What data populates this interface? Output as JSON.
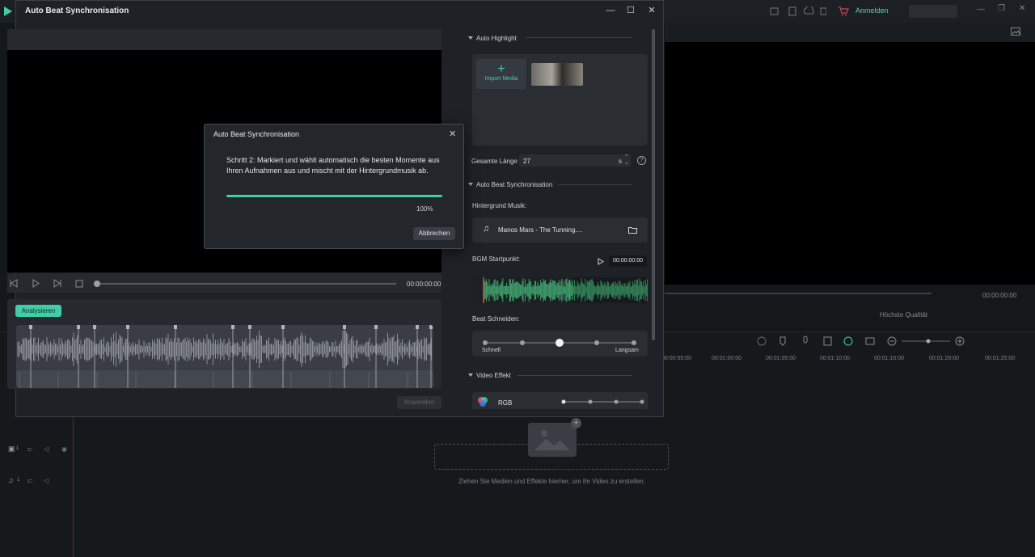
{
  "background_app": {
    "login_label": "Anmelden",
    "time_readout": "00:00:00:00",
    "quality_label": "Höchste Qualität",
    "ruler_labels": [
      "00:00:55:00",
      "00:01:00:00",
      "00:01:05:00",
      "00:01:10:00",
      "00:01:15:00",
      "00:01:20:00",
      "00:01:25:00"
    ],
    "track_video_num": "1",
    "track_audio_num": "1",
    "drop_hint": "Ziehen Sie Medien und Effekte hierher, um Ihr Video zu erstellen."
  },
  "dialog": {
    "title": "Auto Beat Synchronisation",
    "player_time": "00:00:00:00",
    "analyse_button": "Analysieren",
    "apply_button": "Anwenden",
    "auto_highlight": {
      "title": "Auto Highlight",
      "import_label": "Import Media",
      "total_length_label": "Gesamte Länge",
      "total_length_value": "27",
      "total_length_unit": "s"
    },
    "beat_sync": {
      "title": "Auto Beat Synchronisation",
      "music_label": "Hintergrund Musik:",
      "music_name": "Manos Mars - The Tunning....",
      "bgm_start_label": "BGM Startpunkt:",
      "bgm_start_time": "00:00:00:00",
      "beat_cut_label": "Beat Schneiden:",
      "beat_fast": "Schnell",
      "beat_slow": "Langsam",
      "beat_level_index": 2,
      "beat_level_count": 5
    },
    "video_effect": {
      "title": "Video Effekt",
      "effect_name": "RGB"
    }
  },
  "progress": {
    "title": "Auto Beat Synchronisation",
    "message": "Schritt 2: Markiert und wählt automatisch die besten Momente aus Ihren Aufnahmen aus und mischt mit der Hintergrundmusik ab.",
    "percent_value": 100,
    "percent_label": "100%",
    "cancel_button": "Abbrechen"
  },
  "colors": {
    "accent": "#3ecfa6",
    "bgm_wave": "#3fa46e"
  }
}
